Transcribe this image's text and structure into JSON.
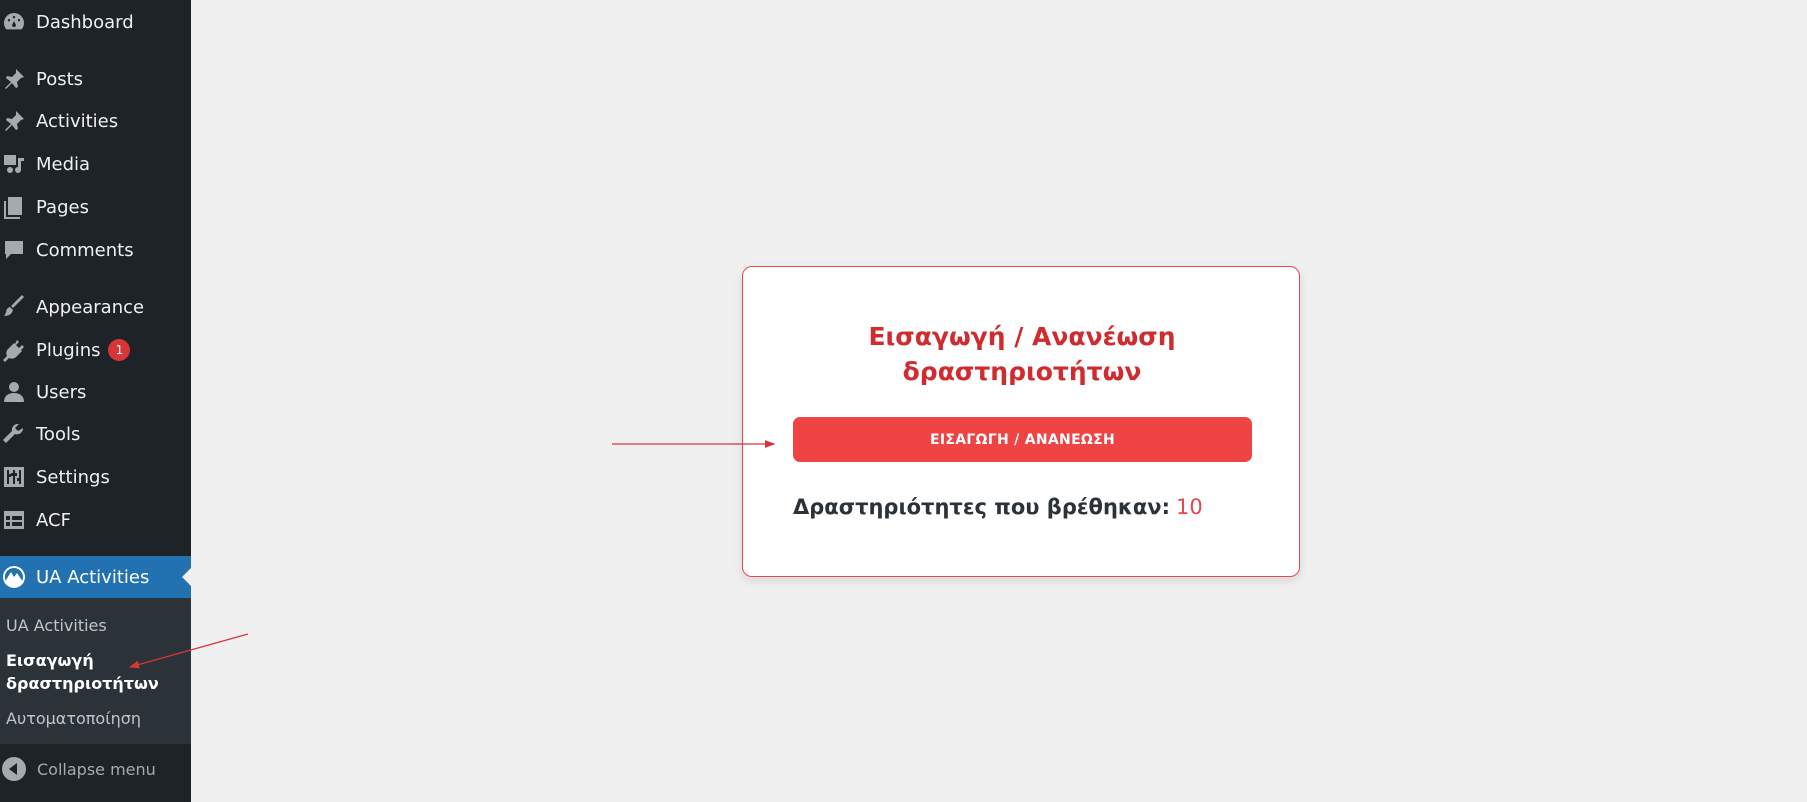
{
  "sidebar": {
    "items": [
      {
        "label": "Dashboard",
        "icon": "dashboard-icon"
      },
      {
        "label": "Posts",
        "icon": "pin-icon"
      },
      {
        "label": "Activities",
        "icon": "pin-icon"
      },
      {
        "label": "Media",
        "icon": "media-icon"
      },
      {
        "label": "Pages",
        "icon": "pages-icon"
      },
      {
        "label": "Comments",
        "icon": "comment-icon"
      },
      {
        "label": "Appearance",
        "icon": "brush-icon"
      },
      {
        "label": "Plugins",
        "icon": "plug-icon",
        "badge": "1"
      },
      {
        "label": "Users",
        "icon": "user-icon"
      },
      {
        "label": "Tools",
        "icon": "wrench-icon"
      },
      {
        "label": "Settings",
        "icon": "sliders-icon"
      },
      {
        "label": "ACF",
        "icon": "table-icon"
      },
      {
        "label": "UA Activities",
        "icon": "mountain-icon"
      }
    ],
    "submenu": [
      "UA Activities",
      "Εισαγωγή",
      "δραστηριοτήτων",
      "Αυτοματοποίηση"
    ],
    "collapse_label": "Collapse menu"
  },
  "card": {
    "title_line1": "Εισαγωγή / Ανανέωση",
    "title_line2": "δραστηριοτήτων",
    "button_label": "ΕΙΣΑΓΩΓΗ / ΑΝΑΝΕΩΣΗ",
    "result_label": "Δραστηριότητες που βρέθηκαν:",
    "result_count": "10"
  },
  "colors": {
    "sidebar_bg": "#1d2327",
    "active_bg": "#2271b1",
    "accent_red": "#ef4444",
    "title_red": "#d02b2f"
  }
}
